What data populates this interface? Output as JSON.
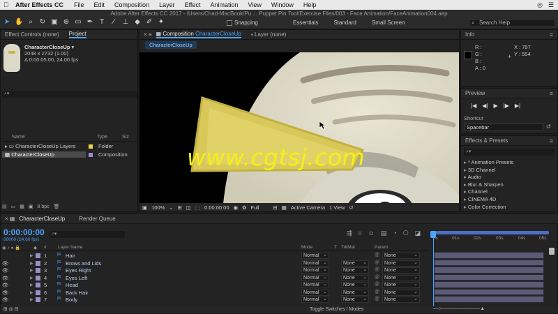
{
  "menubar": {
    "apple": "",
    "app_name": "After Effects CC",
    "items": [
      "File",
      "Edit",
      "Composition",
      "Layer",
      "Effect",
      "Animation",
      "View",
      "Window",
      "Help"
    ]
  },
  "toolbar": {
    "window_title": "Adobe After Effects CC 2017 - /Users/Chad-MacBook/Pu ... Puppet Pin Tool/Exercise Files/003 - Face Animation/FaceAnimation004.aep",
    "snapping_label": "Snapping",
    "workspaces": [
      "Essentials",
      "Standard",
      "Small Screen"
    ],
    "search_help_placeholder": "Search Help"
  },
  "project_panel": {
    "tabs": [
      "Effect Controls (none)",
      "Project"
    ],
    "selected_name": "CharacterCloseUp ▾",
    "size_line": "2048 x 2732 (1.00)",
    "duration_line": "Δ 0:00:05:00, 24.00 fps",
    "columns": {
      "name": "Name",
      "type": "Type",
      "size": "Siz"
    },
    "items": [
      {
        "name": "CharacterCloseUp Layers",
        "type": "Folder",
        "color": "#e6d64a"
      },
      {
        "name": "CharacterCloseUp",
        "type": "Composition",
        "color": "#9a8fc9"
      }
    ],
    "bpc": "8 bpc"
  },
  "comp_panel": {
    "tab_prefix": "Composition",
    "tab_name": "CharacterCloseUp",
    "layer_tab": "Layer (none)",
    "subtab": "CharacterCloseUp",
    "zoom": "100%",
    "timecode": "0:00:00:00",
    "resolution": "Full",
    "camera": "Active Camera",
    "view": "1 View"
  },
  "info_panel": {
    "title": "Info",
    "r": "R :",
    "g": "G :",
    "b": "B :",
    "a": "A : 0",
    "x": "X : 797",
    "y": "Y : 554"
  },
  "preview_panel": {
    "title": "Preview",
    "shortcut_label": "Shortcut",
    "shortcut_value": "Spacebar"
  },
  "effects_panel": {
    "title": "Effects & Presets",
    "items": [
      "* Animation Presets",
      "3D Channel",
      "Audio",
      "Blur & Sharpen",
      "Channel",
      "CINEMA 4D",
      "Color Correction"
    ]
  },
  "timeline": {
    "tabs": [
      "CharacterCloseUp",
      "Render Queue"
    ],
    "timecode": "0:00:00:00",
    "timecode_sub": "00000 (24.00 fps)",
    "columns": {
      "num": "#",
      "layer_name": "Layer Name",
      "mode": "Mode",
      "t": "T",
      "trkmat": "TrkMat",
      "parent": "Parent"
    },
    "ruler_ticks": [
      "0s",
      "01s",
      "02s",
      "03s",
      "04s",
      "05s"
    ],
    "layers": [
      {
        "num": "1",
        "name": "Hair",
        "mode": "Normal",
        "trkmat": "",
        "parent": "None",
        "eye": ""
      },
      {
        "num": "2",
        "name": "Brows and Lids",
        "mode": "Normal",
        "trkmat": "None",
        "parent": "None",
        "eye": "👁"
      },
      {
        "num": "3",
        "name": "Eyes Right",
        "mode": "Normal",
        "trkmat": "None",
        "parent": "None",
        "eye": "👁"
      },
      {
        "num": "4",
        "name": "Eyes Left",
        "mode": "Normal",
        "trkmat": "None",
        "parent": "None",
        "eye": "👁"
      },
      {
        "num": "5",
        "name": "Head",
        "mode": "Normal",
        "trkmat": "None",
        "parent": "None",
        "eye": "👁"
      },
      {
        "num": "6",
        "name": "Back Hair",
        "mode": "Normal",
        "trkmat": "None",
        "parent": "None",
        "eye": "👁"
      },
      {
        "num": "7",
        "name": "Body",
        "mode": "Normal",
        "trkmat": "None",
        "parent": "None",
        "eye": "👁"
      }
    ],
    "toggle_label": "Toggle Switches / Modes"
  },
  "watermark": "www.cgtsj.com",
  "colors": {
    "accent": "#4da3ff",
    "layer_bar": "#5b5b75",
    "watermark": "#f5ef18"
  }
}
